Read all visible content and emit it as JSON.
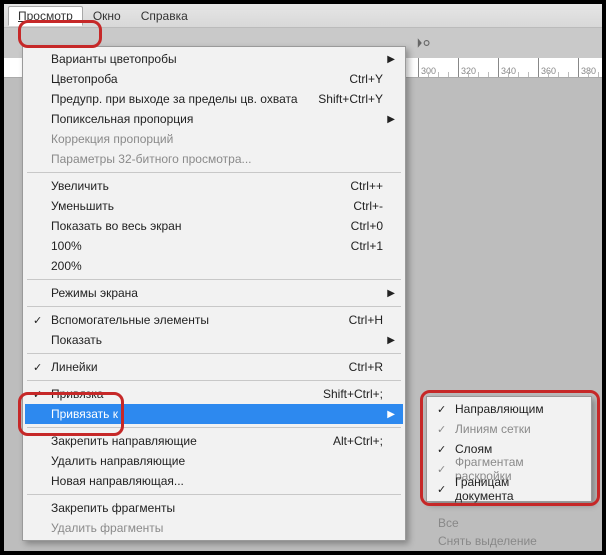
{
  "menubar": {
    "view": "Просмотр",
    "window": "Окно",
    "help": "Справка"
  },
  "ruler_marks": [
    "300",
    "320",
    "340",
    "360",
    "380"
  ],
  "menu": {
    "proofSetup": "Варианты цветопробы",
    "proofColors": {
      "label": "Цветопроба",
      "shortcut": "Ctrl+Y"
    },
    "gamutWarning": {
      "label": "Предупр. при выходе за пределы цв. охвата",
      "shortcut": "Shift+Ctrl+Y"
    },
    "pixelAspect": "Попиксельная пропорция",
    "aspectCorrection": "Коррекция пропорций",
    "bitPreview32": "Параметры 32-битного просмотра...",
    "zoomIn": {
      "label": "Увеличить",
      "shortcut": "Ctrl++"
    },
    "zoomOut": {
      "label": "Уменьшить",
      "shortcut": "Ctrl+-"
    },
    "fitScreen": {
      "label": "Показать во весь экран",
      "shortcut": "Ctrl+0"
    },
    "actual": {
      "label": "100%",
      "shortcut": "Ctrl+1"
    },
    "twoHundred": "200%",
    "screenModes": "Режимы экрана",
    "extras": {
      "label": "Вспомогательные элементы",
      "shortcut": "Ctrl+H"
    },
    "show": "Показать",
    "rulers": {
      "label": "Линейки",
      "shortcut": "Ctrl+R"
    },
    "snap": {
      "label": "Привязка",
      "shortcut": "Shift+Ctrl+;"
    },
    "snapTo": "Привязать к",
    "lockGuides": {
      "label": "Закрепить направляющие",
      "shortcut": "Alt+Ctrl+;"
    },
    "clearGuides": "Удалить направляющие",
    "newGuide": "Новая направляющая...",
    "lockSlices": "Закрепить фрагменты",
    "clearSlices": "Удалить фрагменты"
  },
  "submenu": {
    "guides": "Направляющим",
    "grid": "Линиям сетки",
    "layers": "Слоям",
    "slices": "Фрагментам раскройки",
    "docBounds": "Границам документа"
  },
  "extra": {
    "all": "Все",
    "deselect": "Снять выделение"
  }
}
